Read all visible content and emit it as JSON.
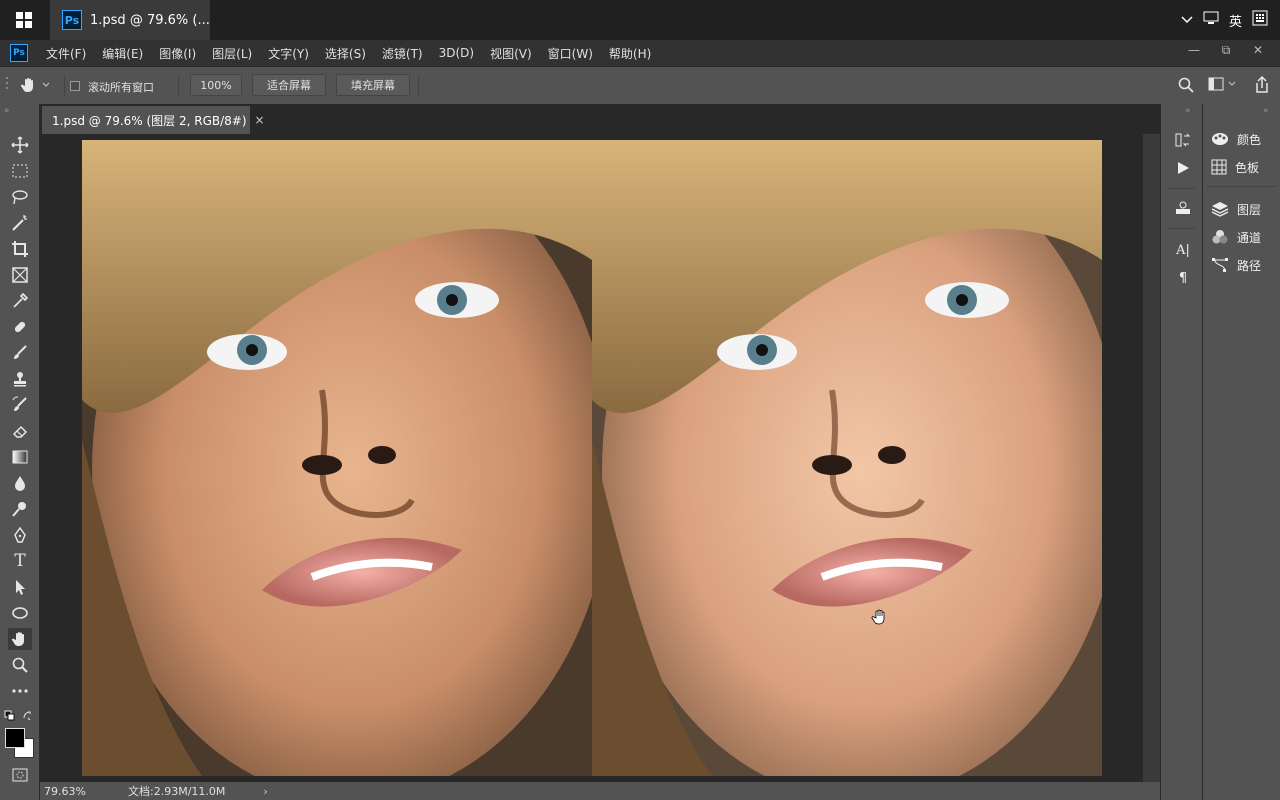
{
  "taskbar": {
    "task_title": "1.psd @ 79.6% (...",
    "app_badge": "Ps",
    "ime_label": "英",
    "tray_icons": [
      "chevron-up-icon",
      "network-icon",
      "ime-icon",
      "keyboard-icon"
    ]
  },
  "menubar": {
    "items": [
      "文件(F)",
      "编辑(E)",
      "图像(I)",
      "图层(L)",
      "文字(Y)",
      "选择(S)",
      "滤镜(T)",
      "3D(D)",
      "视图(V)",
      "窗口(W)",
      "帮助(H)"
    ],
    "window_controls": [
      "—",
      "⧉",
      "✕"
    ]
  },
  "options": {
    "scroll_all_label": "滚动所有窗口",
    "zoom_100": "100%",
    "fit_screen": "适合屏幕",
    "fill_screen": "填充屏幕"
  },
  "document": {
    "tab_title": "1.psd @ 79.6% (图层 2, RGB/8#)",
    "close": "×"
  },
  "status": {
    "zoom": "79.63%",
    "doc_size": "文档:2.93M/11.0M",
    "arrow": "›"
  },
  "panels": {
    "items": [
      "颜色",
      "色板",
      "图层",
      "通道",
      "路径"
    ]
  },
  "colors": {
    "ps_blue": "#31a8ff",
    "ui_dark": "#282828",
    "ui_panel": "#535353"
  }
}
